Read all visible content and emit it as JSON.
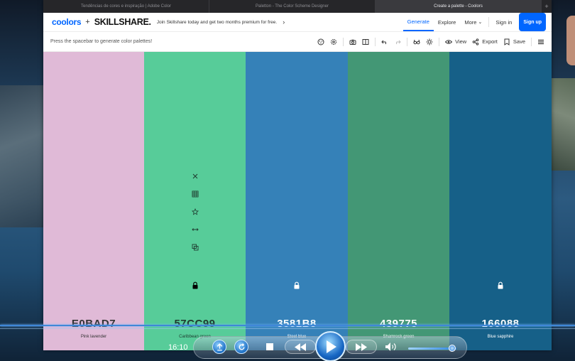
{
  "browser": {
    "tabs": [
      {
        "label": "Tendências de cores e inspiração | Adobe Color",
        "active": false
      },
      {
        "label": "Paletton - The Color Scheme Designer",
        "active": false
      },
      {
        "label": "Create a palette - Coolors",
        "active": true
      }
    ],
    "new_tab_icon": "plus-icon"
  },
  "nav": {
    "logo": "coolors",
    "plus": "+",
    "partner": "SKILLSHARE.",
    "promo": "Join Skillshare today and get two months premium for free.",
    "promo_icon": "chevron-right-icon",
    "generate": "Generate",
    "explore": "Explore",
    "more": "More",
    "sign_in": "Sign in",
    "sign_up": "Sign up",
    "accent": "#0066ff"
  },
  "toolbar": {
    "hint": "Press the spacebar to generate color palettes!",
    "view": "View",
    "export": "Export",
    "save": "Save"
  },
  "palette": [
    {
      "hex": "E0BAD7",
      "name": "Pink lavender",
      "color": "#E0BAD7",
      "text": "#333333",
      "locked": false,
      "show_tools": false
    },
    {
      "hex": "57CC99",
      "name": "Caribbean green",
      "color": "#57CC99",
      "text": "#1f3a2f",
      "locked": true,
      "show_tools": true
    },
    {
      "hex": "3581B8",
      "name": "Steel blue",
      "color": "#3581B8",
      "text": "#ffffff",
      "locked": true,
      "show_tools": false
    },
    {
      "hex": "439775",
      "name": "Shamrock green",
      "color": "#439775",
      "text": "#ffffff",
      "locked": false,
      "show_tools": false
    },
    {
      "hex": "166088",
      "name": "Blue sapphire",
      "color": "#166088",
      "text": "#ffffff",
      "locked": true,
      "show_tools": false
    }
  ],
  "player": {
    "time": "16:10",
    "volume_fraction": 0.85
  }
}
